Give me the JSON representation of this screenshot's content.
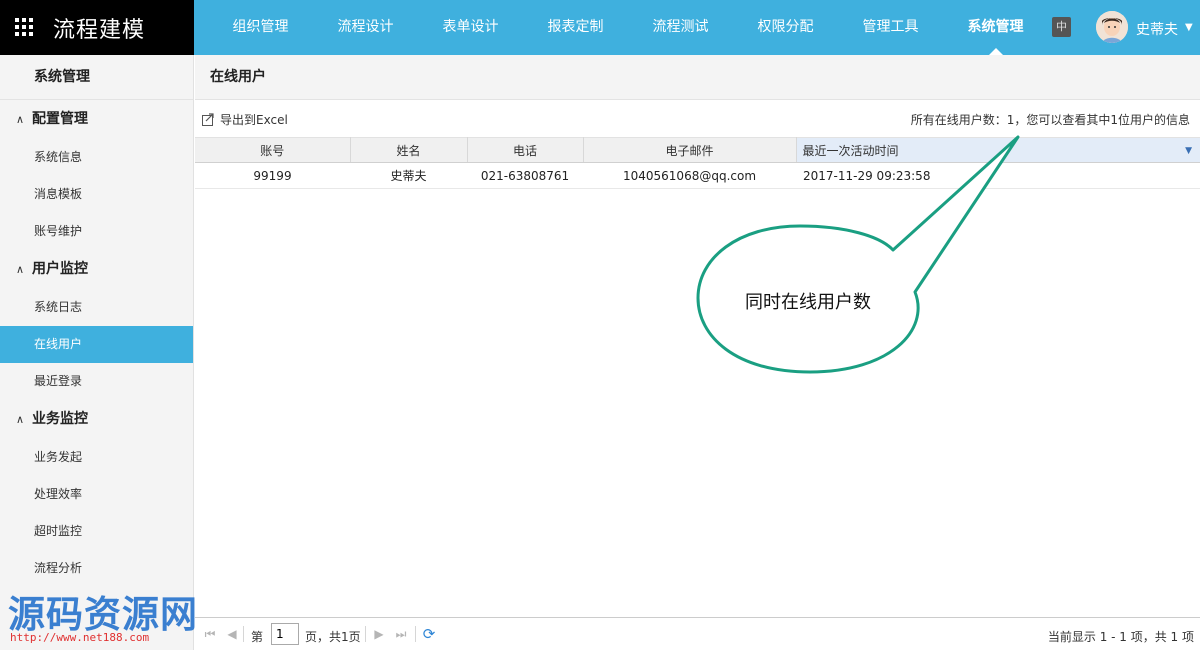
{
  "brand": {
    "title": "流程建模"
  },
  "nav": {
    "items": [
      "组织管理",
      "流程设计",
      "表单设计",
      "报表定制",
      "流程测试",
      "权限分配",
      "管理工具",
      "系统管理"
    ],
    "active": "系统管理"
  },
  "header": {
    "lang": "中",
    "user_name": "史蒂夫"
  },
  "sidebar": {
    "title": "系统管理",
    "groups": [
      {
        "label": "配置管理",
        "items": [
          "系统信息",
          "消息模板",
          "账号维护"
        ]
      },
      {
        "label": "用户监控",
        "items": [
          "系统日志",
          "在线用户",
          "最近登录"
        ]
      },
      {
        "label": "业务监控",
        "items": [
          "业务发起",
          "处理效率",
          "超时监控",
          "流程分析"
        ]
      }
    ],
    "active_item": "在线用户"
  },
  "main": {
    "page_title": "在线用户",
    "export_label": "导出到Excel",
    "summary": "所有在线用户数：1，您可以查看其中1位用户的信息",
    "columns": [
      "账号",
      "姓名",
      "电话",
      "电子邮件",
      "最近一次活动时间"
    ],
    "rows": [
      [
        "99199",
        "史蒂夫",
        "021-63808761",
        "1040561068@qq.com",
        "2017-11-29 09:23:58"
      ]
    ]
  },
  "callout": {
    "text": "同时在线用户数",
    "border_color": "#1a9f82"
  },
  "pager": {
    "page_prefix": "第",
    "page_value": "1",
    "page_suffix": "页，共1页",
    "summary": "当前显示 1 - 1 项，共 1 项"
  },
  "watermark": {
    "text": "源码资源网",
    "url": "http://www.net188.com"
  },
  "colors": {
    "accent": "#3fb0de",
    "brand_bg": "#000000"
  }
}
